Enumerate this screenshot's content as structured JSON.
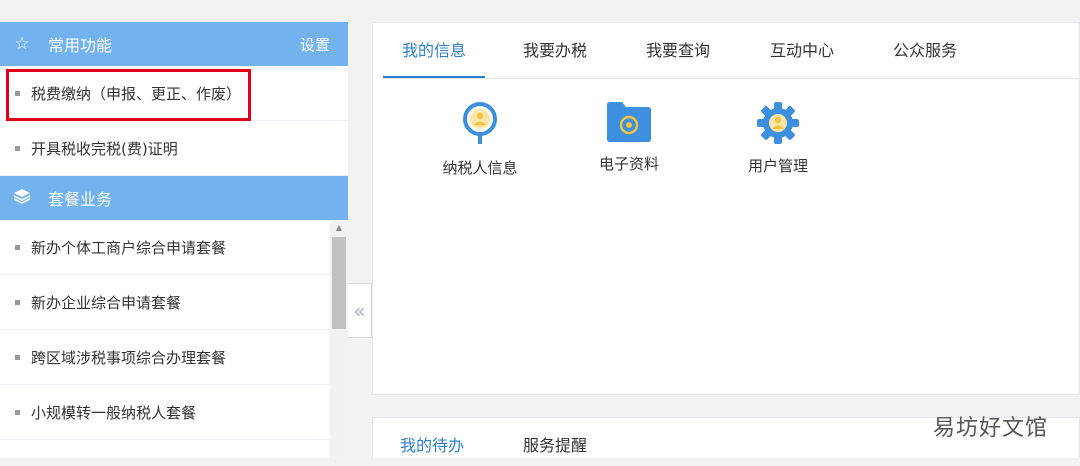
{
  "sidebar": {
    "common": {
      "title": "常用功能",
      "settings_label": "设置",
      "items": [
        {
          "label": "税费缴纳（申报、更正、作废）"
        },
        {
          "label": "开具税收完税(费)证明"
        }
      ]
    },
    "packages": {
      "title": "套餐业务",
      "items": [
        {
          "label": "新办个体工商户综合申请套餐"
        },
        {
          "label": "新办企业综合申请套餐"
        },
        {
          "label": "跨区域涉税事项综合办理套餐"
        },
        {
          "label": "小规模转一般纳税人套餐"
        }
      ]
    },
    "collapse_glyph": "«"
  },
  "main": {
    "tabs": [
      {
        "label": "我的信息"
      },
      {
        "label": "我要办税"
      },
      {
        "label": "我要查询"
      },
      {
        "label": "互动中心"
      },
      {
        "label": "公众服务"
      }
    ],
    "active_tab": "我的信息",
    "functions": [
      {
        "label": "纳税人信息",
        "icon": "taxpayer-info-icon"
      },
      {
        "label": "电子资料",
        "icon": "folder-icon"
      },
      {
        "label": "用户管理",
        "icon": "user-gear-icon"
      }
    ]
  },
  "bottom": {
    "tabs": [
      {
        "label": "我的待办"
      },
      {
        "label": "服务提醒"
      }
    ]
  },
  "watermark": "易坊好文馆",
  "colors": {
    "header_blue": "#72b2ee",
    "accent_blue": "#2f7fd0",
    "icon_blue": "#3d8fe0",
    "icon_yellow": "#f5c242",
    "highlight_red": "#e0001a"
  }
}
